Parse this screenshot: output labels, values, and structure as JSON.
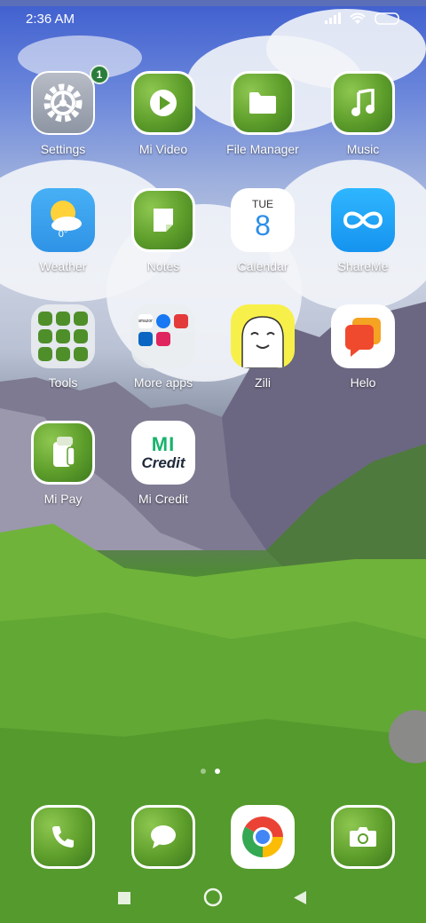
{
  "status_bar": {
    "time": "2:36 AM",
    "icons": [
      "signal-icon",
      "wifi-icon",
      "battery-icon"
    ]
  },
  "apps": [
    {
      "label": "Settings",
      "icon": "gear-icon",
      "badge": "1"
    },
    {
      "label": "Mi Video",
      "icon": "play-icon"
    },
    {
      "label": "File Manager",
      "icon": "folder-icon"
    },
    {
      "label": "Music",
      "icon": "music-note-icon"
    },
    {
      "label": "Weather",
      "icon": "sun-cloud-icon",
      "value": "0°"
    },
    {
      "label": "Notes",
      "icon": "note-icon"
    },
    {
      "label": "Calendar",
      "icon": "calendar-icon",
      "day": "TUE",
      "date": "8"
    },
    {
      "label": "ShareMe",
      "icon": "infinity-icon"
    },
    {
      "label": "Tools",
      "icon": "folder-grid-icon"
    },
    {
      "label": "More apps",
      "icon": "folder-grid-icon",
      "mini_labels": [
        "amazon"
      ]
    },
    {
      "label": "Zili",
      "icon": "zili-face-icon"
    },
    {
      "label": "Helo",
      "icon": "chat-bubbles-icon"
    },
    {
      "label": "Mi Pay",
      "icon": "wallet-icon"
    },
    {
      "label": "Mi Credit",
      "icon": "mi-credit-logo-icon",
      "logo_top": "MI",
      "logo_bottom": "Credit"
    }
  ],
  "dock": [
    {
      "name": "phone",
      "icon": "phone-icon"
    },
    {
      "name": "messaging",
      "icon": "message-bubble-icon"
    },
    {
      "name": "chrome",
      "icon": "chrome-icon"
    },
    {
      "name": "camera",
      "icon": "camera-icon"
    }
  ],
  "page_indicator": {
    "pages": 2,
    "current": 2
  },
  "nav": [
    "recents-icon",
    "home-icon",
    "back-icon"
  ]
}
